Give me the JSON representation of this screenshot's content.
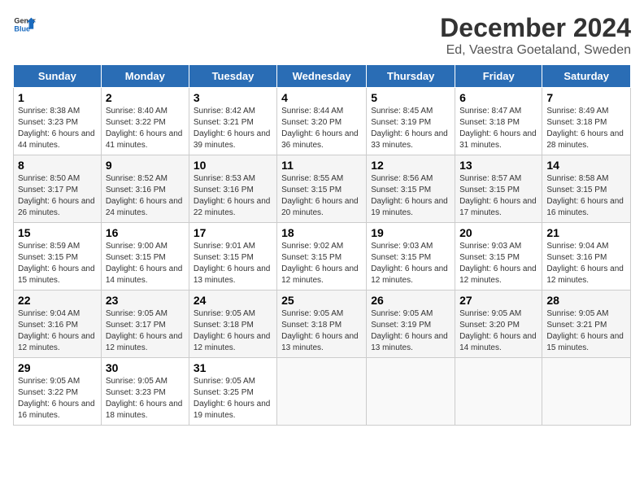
{
  "logo": {
    "text_general": "General",
    "text_blue": "Blue"
  },
  "title": "December 2024",
  "subtitle": "Ed, Vaestra Goetaland, Sweden",
  "days_header": [
    "Sunday",
    "Monday",
    "Tuesday",
    "Wednesday",
    "Thursday",
    "Friday",
    "Saturday"
  ],
  "weeks": [
    [
      {
        "day": "1",
        "sunrise": "8:38 AM",
        "sunset": "3:23 PM",
        "daylight": "6 hours and 44 minutes."
      },
      {
        "day": "2",
        "sunrise": "8:40 AM",
        "sunset": "3:22 PM",
        "daylight": "6 hours and 41 minutes."
      },
      {
        "day": "3",
        "sunrise": "8:42 AM",
        "sunset": "3:21 PM",
        "daylight": "6 hours and 39 minutes."
      },
      {
        "day": "4",
        "sunrise": "8:44 AM",
        "sunset": "3:20 PM",
        "daylight": "6 hours and 36 minutes."
      },
      {
        "day": "5",
        "sunrise": "8:45 AM",
        "sunset": "3:19 PM",
        "daylight": "6 hours and 33 minutes."
      },
      {
        "day": "6",
        "sunrise": "8:47 AM",
        "sunset": "3:18 PM",
        "daylight": "6 hours and 31 minutes."
      },
      {
        "day": "7",
        "sunrise": "8:49 AM",
        "sunset": "3:18 PM",
        "daylight": "6 hours and 28 minutes."
      }
    ],
    [
      {
        "day": "8",
        "sunrise": "8:50 AM",
        "sunset": "3:17 PM",
        "daylight": "6 hours and 26 minutes."
      },
      {
        "day": "9",
        "sunrise": "8:52 AM",
        "sunset": "3:16 PM",
        "daylight": "6 hours and 24 minutes."
      },
      {
        "day": "10",
        "sunrise": "8:53 AM",
        "sunset": "3:16 PM",
        "daylight": "6 hours and 22 minutes."
      },
      {
        "day": "11",
        "sunrise": "8:55 AM",
        "sunset": "3:15 PM",
        "daylight": "6 hours and 20 minutes."
      },
      {
        "day": "12",
        "sunrise": "8:56 AM",
        "sunset": "3:15 PM",
        "daylight": "6 hours and 19 minutes."
      },
      {
        "day": "13",
        "sunrise": "8:57 AM",
        "sunset": "3:15 PM",
        "daylight": "6 hours and 17 minutes."
      },
      {
        "day": "14",
        "sunrise": "8:58 AM",
        "sunset": "3:15 PM",
        "daylight": "6 hours and 16 minutes."
      }
    ],
    [
      {
        "day": "15",
        "sunrise": "8:59 AM",
        "sunset": "3:15 PM",
        "daylight": "6 hours and 15 minutes."
      },
      {
        "day": "16",
        "sunrise": "9:00 AM",
        "sunset": "3:15 PM",
        "daylight": "6 hours and 14 minutes."
      },
      {
        "day": "17",
        "sunrise": "9:01 AM",
        "sunset": "3:15 PM",
        "daylight": "6 hours and 13 minutes."
      },
      {
        "day": "18",
        "sunrise": "9:02 AM",
        "sunset": "3:15 PM",
        "daylight": "6 hours and 12 minutes."
      },
      {
        "day": "19",
        "sunrise": "9:03 AM",
        "sunset": "3:15 PM",
        "daylight": "6 hours and 12 minutes."
      },
      {
        "day": "20",
        "sunrise": "9:03 AM",
        "sunset": "3:15 PM",
        "daylight": "6 hours and 12 minutes."
      },
      {
        "day": "21",
        "sunrise": "9:04 AM",
        "sunset": "3:16 PM",
        "daylight": "6 hours and 12 minutes."
      }
    ],
    [
      {
        "day": "22",
        "sunrise": "9:04 AM",
        "sunset": "3:16 PM",
        "daylight": "6 hours and 12 minutes."
      },
      {
        "day": "23",
        "sunrise": "9:05 AM",
        "sunset": "3:17 PM",
        "daylight": "6 hours and 12 minutes."
      },
      {
        "day": "24",
        "sunrise": "9:05 AM",
        "sunset": "3:18 PM",
        "daylight": "6 hours and 12 minutes."
      },
      {
        "day": "25",
        "sunrise": "9:05 AM",
        "sunset": "3:18 PM",
        "daylight": "6 hours and 13 minutes."
      },
      {
        "day": "26",
        "sunrise": "9:05 AM",
        "sunset": "3:19 PM",
        "daylight": "6 hours and 13 minutes."
      },
      {
        "day": "27",
        "sunrise": "9:05 AM",
        "sunset": "3:20 PM",
        "daylight": "6 hours and 14 minutes."
      },
      {
        "day": "28",
        "sunrise": "9:05 AM",
        "sunset": "3:21 PM",
        "daylight": "6 hours and 15 minutes."
      }
    ],
    [
      {
        "day": "29",
        "sunrise": "9:05 AM",
        "sunset": "3:22 PM",
        "daylight": "6 hours and 16 minutes."
      },
      {
        "day": "30",
        "sunrise": "9:05 AM",
        "sunset": "3:23 PM",
        "daylight": "6 hours and 18 minutes."
      },
      {
        "day": "31",
        "sunrise": "9:05 AM",
        "sunset": "3:25 PM",
        "daylight": "6 hours and 19 minutes."
      },
      null,
      null,
      null,
      null
    ]
  ],
  "labels": {
    "sunrise": "Sunrise:",
    "sunset": "Sunset:",
    "daylight": "Daylight hours"
  }
}
